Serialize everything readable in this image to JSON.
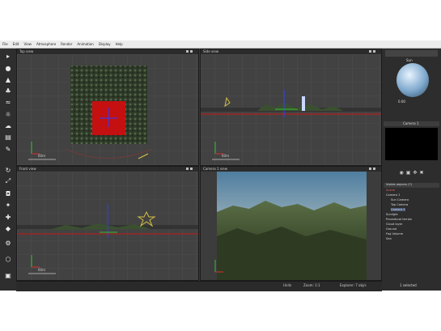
{
  "menu": [
    "File",
    "Edit",
    "View",
    "Atmosphere",
    "Render",
    "Animation",
    "Display",
    "Help"
  ],
  "viewports": {
    "top": {
      "title": "Top view"
    },
    "side": {
      "title": "Side view"
    },
    "front": {
      "title": "Front view"
    },
    "camera": {
      "title": "Camera 1 view"
    }
  },
  "sidebar": {
    "sun_label": "Sun",
    "sun_value": "0.00",
    "camera_label": "Camera 1",
    "tree_header": "Visible objects (7)",
    "tree": [
      "Scene",
      "Camera 1",
      "Sun Camera",
      "Top Camera",
      "Camera 1",
      "Sunlight",
      "Procedural terrain",
      "Cloud layer",
      "Ground",
      "Fog Volume",
      "Sea"
    ]
  },
  "status": {
    "left": "Units",
    "mid": "Zoom: 1:1",
    "right": "Explorer: 7 obj/s",
    "far": "1 selected"
  },
  "scale": "60m",
  "toolbar_icons": [
    "select-icon",
    "sphere-icon",
    "terrain-icon",
    "population-icon",
    "water-icon",
    "sun-icon",
    "cloud-icon",
    "clipboard-icon",
    "brush-icon",
    "rotate-icon",
    "scale-icon",
    "camera-icon",
    "light-icon",
    "axis-icon",
    "node-icon",
    "settings-icon",
    "gizmo-icon"
  ]
}
